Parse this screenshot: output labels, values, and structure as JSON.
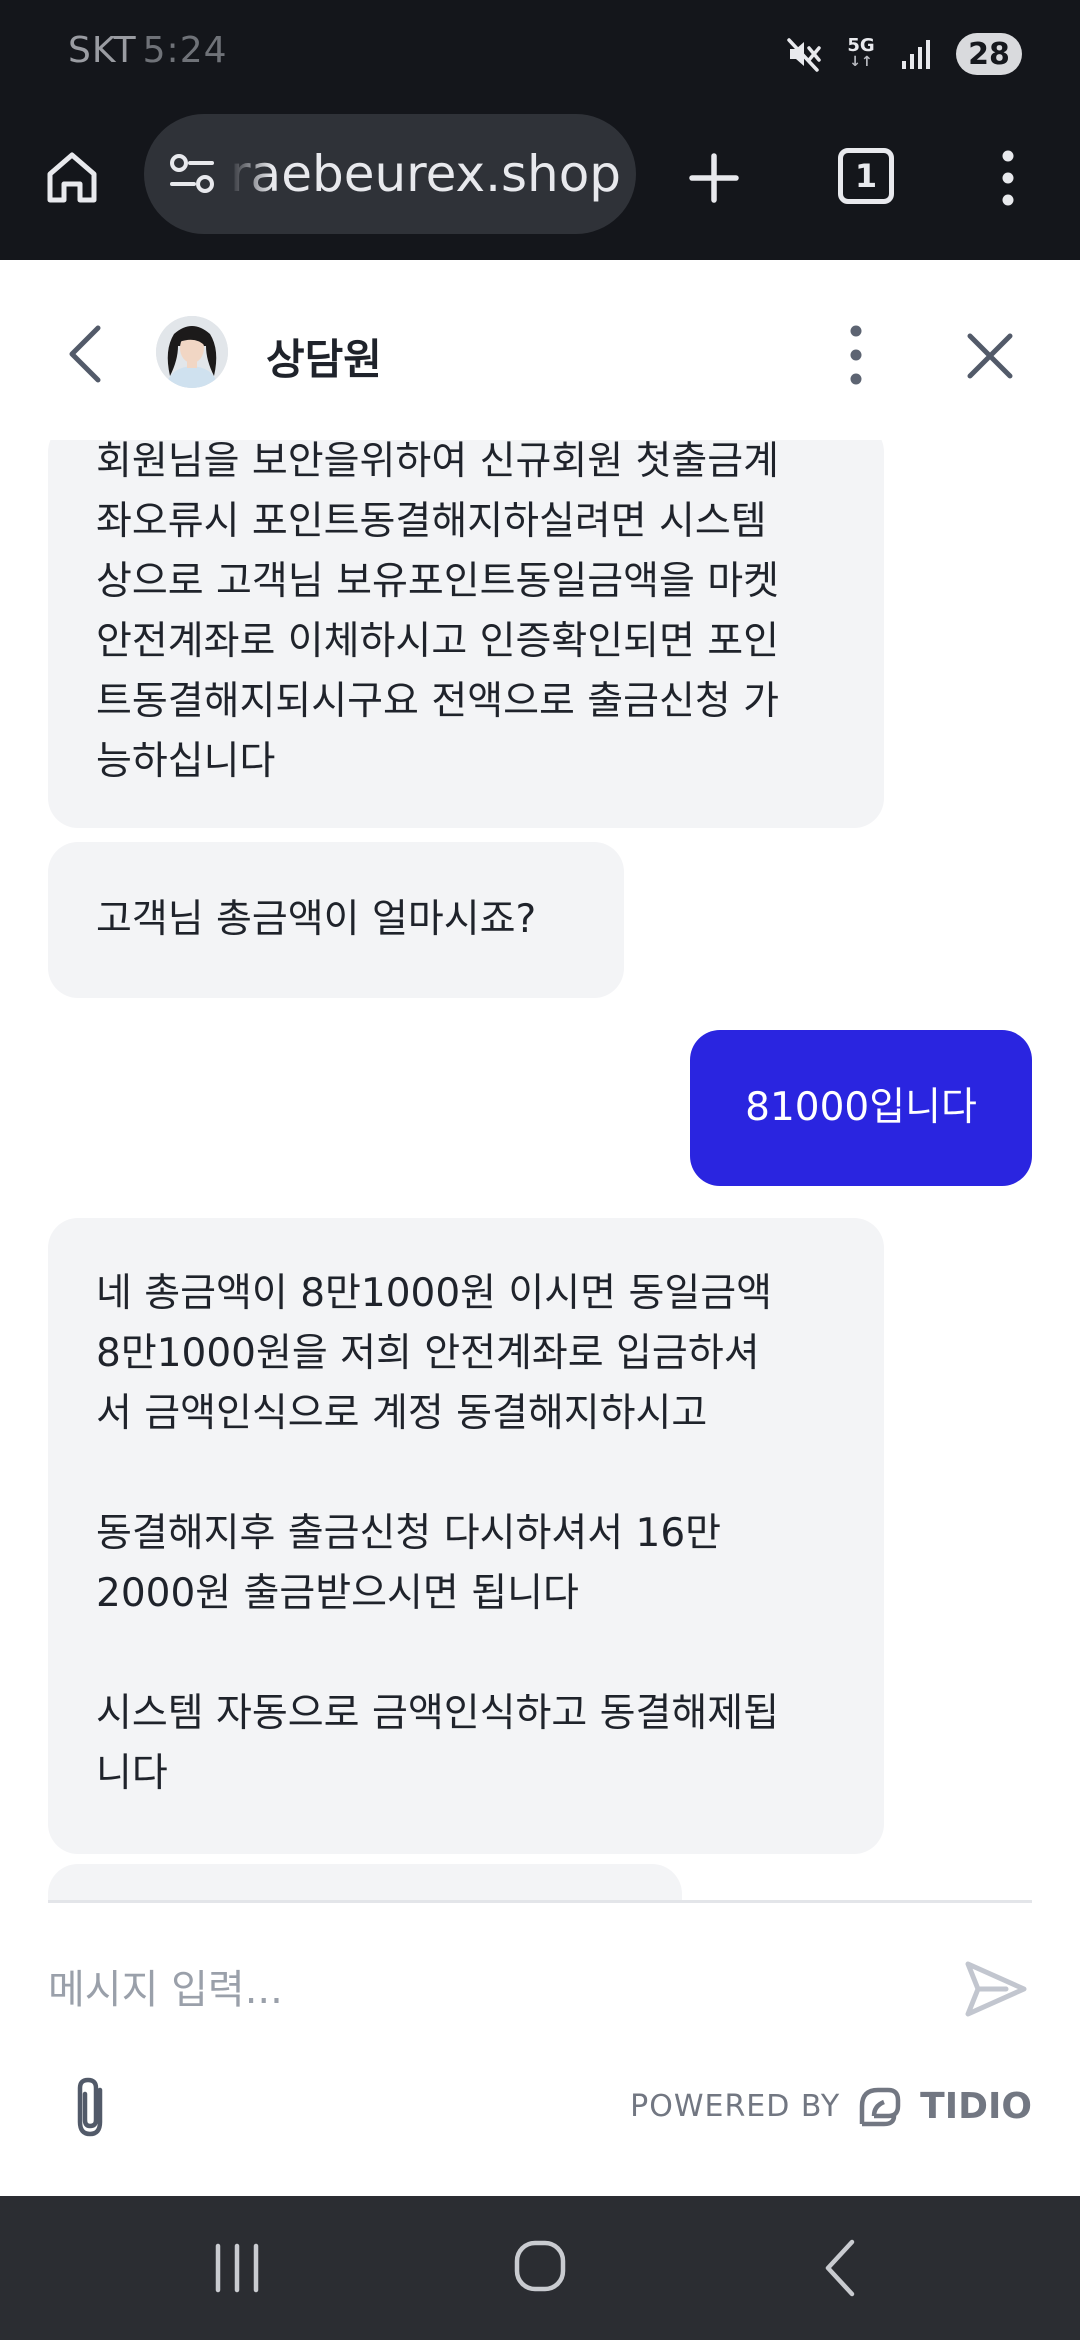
{
  "status_bar": {
    "carrier": "SKT",
    "time": "5:24",
    "network": "5G",
    "battery": "28",
    "icons": [
      "mute-icon",
      "5g-icon",
      "signal-icon"
    ]
  },
  "browser": {
    "url": "raebeurex.shop",
    "tab_count": "1"
  },
  "chat_header": {
    "agent_name": "상담원"
  },
  "messages": [
    {
      "from": "operator",
      "text": "회원님을 보안을위하여 신규회원 첫출금계\n좌오류시 포인트동결해지하실려면 시스템\n상으로 고객님 보유포인트동일금액을 마켓\n안전계좌로 이체하시고 인증확인되면 포인\n트동결해지되시구요 전액으로 출금신청 가\n능하십니다"
    },
    {
      "from": "operator",
      "text": "고객님 총금액이 얼마시죠?"
    },
    {
      "from": "visitor",
      "text": "81000입니다"
    },
    {
      "from": "operator",
      "text": "네 총금액이 8만1000원 이시면 동일금액\n8만1000원을 저희 안전계좌로 입금하셔\n서 금액인식으로 계정 동결해지하시고\n\n동결해지후 출금신청 다시하셔서 16만\n2000원 출금받으시면 됩니다\n\n시스템 자동으로 금액인식하고 동결해제됩\n니다"
    }
  ],
  "composer": {
    "placeholder": "메시지 입력...",
    "powered_by": "POWERED BY",
    "brand": "TIDIO"
  },
  "colors": {
    "visitor_bubble": "#2a25e0",
    "operator_bubble": "#f3f4f6",
    "chrome_bg": "#14161b",
    "nav_bg": "#2b2d32"
  }
}
